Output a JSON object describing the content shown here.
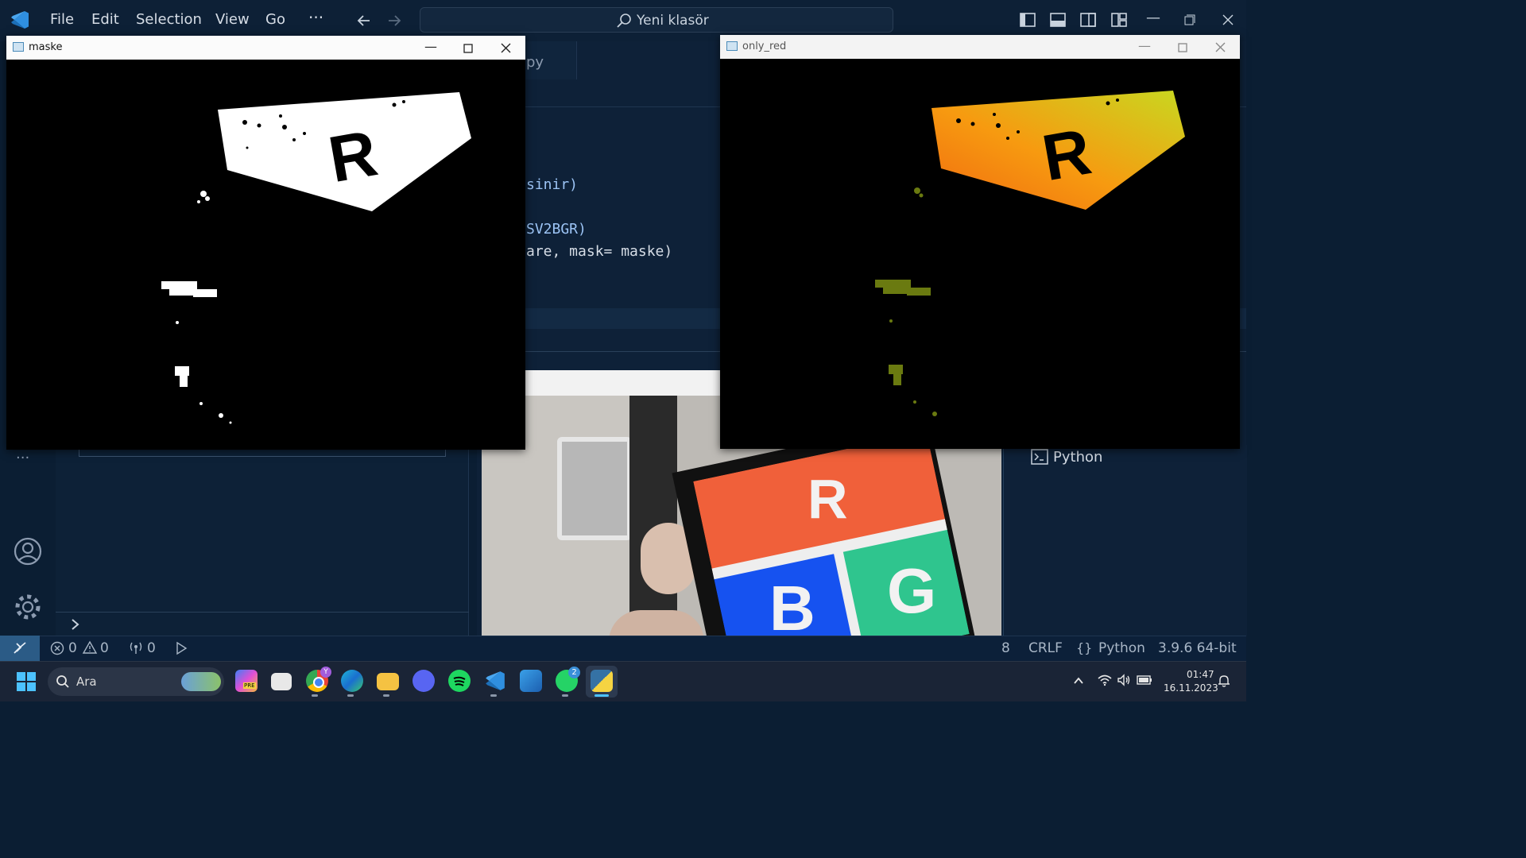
{
  "vscode": {
    "menu": [
      "File",
      "Edit",
      "Selection",
      "View",
      "Go",
      "···"
    ],
    "search_text": "Yeni klasör",
    "tab_fragment": "py",
    "code_lines": [
      "sinir)",
      "SV2BGR)",
      "are, mask= maske)"
    ],
    "sidebar_more": "···",
    "terminal_item": "Python",
    "status": {
      "errors": "0",
      "warnings": "0",
      "ports": "0",
      "line_fragment": "8",
      "eol": "CRLF",
      "language": "Python",
      "interpreter": "3.9.6 64-bit"
    }
  },
  "windows": {
    "maske": {
      "title": "maske"
    },
    "only_red": {
      "title": "only_red"
    }
  },
  "camera_card_letters": [
    "R",
    "B",
    "G"
  ],
  "mask_letter": "R",
  "taskbar": {
    "search_placeholder": "Ara",
    "whatsapp_badge": "2",
    "chrome_badge": "Y",
    "pre_badge": "PRE",
    "time": "01:47",
    "date": "16.11.2023"
  },
  "colors": {
    "vscode_bg": "#0b1e33",
    "accent": "#2b5b86",
    "taskbar": "#1a2436"
  }
}
